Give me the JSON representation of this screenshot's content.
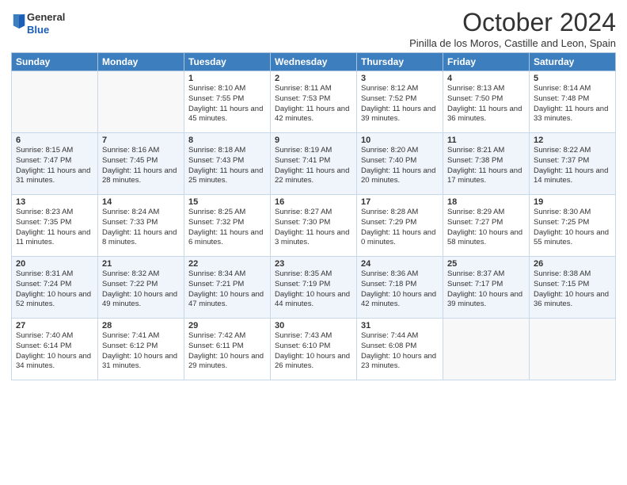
{
  "logo": {
    "line1": "General",
    "line2": "Blue"
  },
  "title": "October 2024",
  "location": "Pinilla de los Moros, Castille and Leon, Spain",
  "headers": [
    "Sunday",
    "Monday",
    "Tuesday",
    "Wednesday",
    "Thursday",
    "Friday",
    "Saturday"
  ],
  "weeks": [
    [
      {
        "day": "",
        "info": ""
      },
      {
        "day": "",
        "info": ""
      },
      {
        "day": "1",
        "info": "Sunrise: 8:10 AM\nSunset: 7:55 PM\nDaylight: 11 hours and 45 minutes."
      },
      {
        "day": "2",
        "info": "Sunrise: 8:11 AM\nSunset: 7:53 PM\nDaylight: 11 hours and 42 minutes."
      },
      {
        "day": "3",
        "info": "Sunrise: 8:12 AM\nSunset: 7:52 PM\nDaylight: 11 hours and 39 minutes."
      },
      {
        "day": "4",
        "info": "Sunrise: 8:13 AM\nSunset: 7:50 PM\nDaylight: 11 hours and 36 minutes."
      },
      {
        "day": "5",
        "info": "Sunrise: 8:14 AM\nSunset: 7:48 PM\nDaylight: 11 hours and 33 minutes."
      }
    ],
    [
      {
        "day": "6",
        "info": "Sunrise: 8:15 AM\nSunset: 7:47 PM\nDaylight: 11 hours and 31 minutes."
      },
      {
        "day": "7",
        "info": "Sunrise: 8:16 AM\nSunset: 7:45 PM\nDaylight: 11 hours and 28 minutes."
      },
      {
        "day": "8",
        "info": "Sunrise: 8:18 AM\nSunset: 7:43 PM\nDaylight: 11 hours and 25 minutes."
      },
      {
        "day": "9",
        "info": "Sunrise: 8:19 AM\nSunset: 7:41 PM\nDaylight: 11 hours and 22 minutes."
      },
      {
        "day": "10",
        "info": "Sunrise: 8:20 AM\nSunset: 7:40 PM\nDaylight: 11 hours and 20 minutes."
      },
      {
        "day": "11",
        "info": "Sunrise: 8:21 AM\nSunset: 7:38 PM\nDaylight: 11 hours and 17 minutes."
      },
      {
        "day": "12",
        "info": "Sunrise: 8:22 AM\nSunset: 7:37 PM\nDaylight: 11 hours and 14 minutes."
      }
    ],
    [
      {
        "day": "13",
        "info": "Sunrise: 8:23 AM\nSunset: 7:35 PM\nDaylight: 11 hours and 11 minutes."
      },
      {
        "day": "14",
        "info": "Sunrise: 8:24 AM\nSunset: 7:33 PM\nDaylight: 11 hours and 8 minutes."
      },
      {
        "day": "15",
        "info": "Sunrise: 8:25 AM\nSunset: 7:32 PM\nDaylight: 11 hours and 6 minutes."
      },
      {
        "day": "16",
        "info": "Sunrise: 8:27 AM\nSunset: 7:30 PM\nDaylight: 11 hours and 3 minutes."
      },
      {
        "day": "17",
        "info": "Sunrise: 8:28 AM\nSunset: 7:29 PM\nDaylight: 11 hours and 0 minutes."
      },
      {
        "day": "18",
        "info": "Sunrise: 8:29 AM\nSunset: 7:27 PM\nDaylight: 10 hours and 58 minutes."
      },
      {
        "day": "19",
        "info": "Sunrise: 8:30 AM\nSunset: 7:25 PM\nDaylight: 10 hours and 55 minutes."
      }
    ],
    [
      {
        "day": "20",
        "info": "Sunrise: 8:31 AM\nSunset: 7:24 PM\nDaylight: 10 hours and 52 minutes."
      },
      {
        "day": "21",
        "info": "Sunrise: 8:32 AM\nSunset: 7:22 PM\nDaylight: 10 hours and 49 minutes."
      },
      {
        "day": "22",
        "info": "Sunrise: 8:34 AM\nSunset: 7:21 PM\nDaylight: 10 hours and 47 minutes."
      },
      {
        "day": "23",
        "info": "Sunrise: 8:35 AM\nSunset: 7:19 PM\nDaylight: 10 hours and 44 minutes."
      },
      {
        "day": "24",
        "info": "Sunrise: 8:36 AM\nSunset: 7:18 PM\nDaylight: 10 hours and 42 minutes."
      },
      {
        "day": "25",
        "info": "Sunrise: 8:37 AM\nSunset: 7:17 PM\nDaylight: 10 hours and 39 minutes."
      },
      {
        "day": "26",
        "info": "Sunrise: 8:38 AM\nSunset: 7:15 PM\nDaylight: 10 hours and 36 minutes."
      }
    ],
    [
      {
        "day": "27",
        "info": "Sunrise: 7:40 AM\nSunset: 6:14 PM\nDaylight: 10 hours and 34 minutes."
      },
      {
        "day": "28",
        "info": "Sunrise: 7:41 AM\nSunset: 6:12 PM\nDaylight: 10 hours and 31 minutes."
      },
      {
        "day": "29",
        "info": "Sunrise: 7:42 AM\nSunset: 6:11 PM\nDaylight: 10 hours and 29 minutes."
      },
      {
        "day": "30",
        "info": "Sunrise: 7:43 AM\nSunset: 6:10 PM\nDaylight: 10 hours and 26 minutes."
      },
      {
        "day": "31",
        "info": "Sunrise: 7:44 AM\nSunset: 6:08 PM\nDaylight: 10 hours and 23 minutes."
      },
      {
        "day": "",
        "info": ""
      },
      {
        "day": "",
        "info": ""
      }
    ]
  ]
}
